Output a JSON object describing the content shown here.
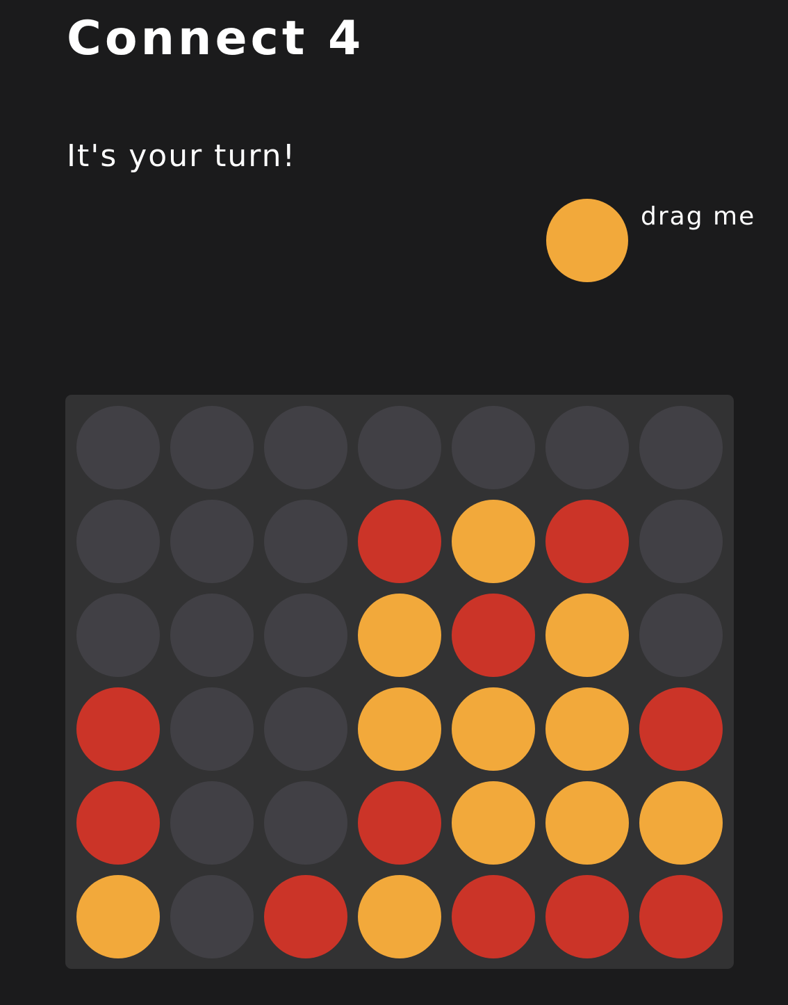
{
  "title": "Connect 4",
  "status": "It's your turn!",
  "drag_hint": "drag me",
  "current_piece": "yellow",
  "colors": {
    "background": "#1b1b1c",
    "board": "#323233",
    "empty": "#414045",
    "red": "#cb3428",
    "yellow": "#f2a93b"
  },
  "board": {
    "rows": 6,
    "columns": 7,
    "cells": [
      [
        "empty",
        "empty",
        "empty",
        "empty",
        "empty",
        "empty",
        "empty"
      ],
      [
        "empty",
        "empty",
        "empty",
        "red",
        "yellow",
        "red",
        "empty"
      ],
      [
        "empty",
        "empty",
        "empty",
        "yellow",
        "red",
        "yellow",
        "empty"
      ],
      [
        "red",
        "empty",
        "empty",
        "yellow",
        "yellow",
        "yellow",
        "red"
      ],
      [
        "red",
        "empty",
        "empty",
        "red",
        "yellow",
        "yellow",
        "yellow"
      ],
      [
        "yellow",
        "empty",
        "red",
        "yellow",
        "red",
        "red",
        "red"
      ]
    ]
  }
}
